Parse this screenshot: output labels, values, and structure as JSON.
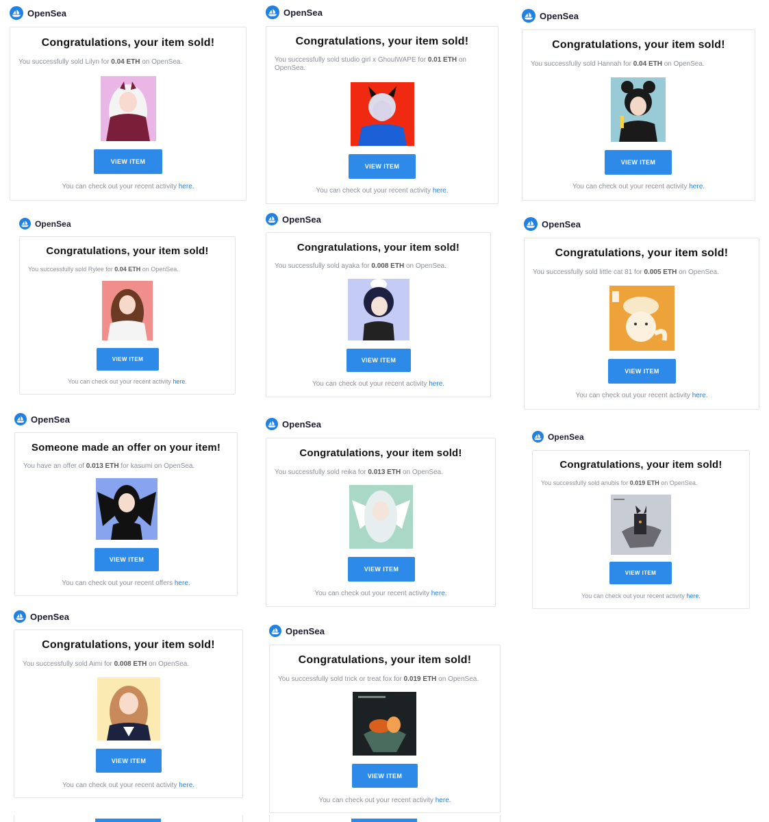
{
  "brand": "OpenSea",
  "button_label": "VIEW ITEM",
  "link_label": "here.",
  "colors": {
    "accent": "#2e8ae8",
    "link": "#2081e2",
    "muted": "#8a8f98"
  },
  "cards": [
    {
      "title": "Congratulations, your item sold!",
      "pre": "You successfully sold Lilyn for ",
      "amount": "0.04 ETH",
      "post": " on OpenSea.",
      "foot": "You can check out your recent activity "
    },
    {
      "title": "Congratulations, your item sold!",
      "pre": "You successfully sold studio girl x GhoulWAPE for ",
      "amount": "0.01 ETH",
      "post": " on OpenSea.",
      "foot": "You can check out your recent activity "
    },
    {
      "title": "Congratulations, your item sold!",
      "pre": "You successfully sold Hannah for ",
      "amount": "0.04 ETH",
      "post": " on OpenSea.",
      "foot": "You can check out your recent activity "
    },
    {
      "title": "Congratulations, your item sold!",
      "pre": "You successfully sold Rylee for ",
      "amount": "0.04 ETH",
      "post": " on OpenSea.",
      "foot": "You can check out your recent activity "
    },
    {
      "title": "Congratulations, your item sold!",
      "pre": "You successfully sold ayaka for ",
      "amount": "0.008 ETH",
      "post": " on OpenSea.",
      "foot": "You can check out your recent activity "
    },
    {
      "title": "Congratulations, your item sold!",
      "pre": "You successfully sold little cat 81 for ",
      "amount": "0.005 ETH",
      "post": " on OpenSea.",
      "foot": "You can check out your recent activity "
    },
    {
      "title": "Someone made an offer on your item!",
      "pre": "You have an offer of ",
      "amount": "0.013 ETH",
      "post": " for kasumi on OpenSea.",
      "foot": "You can check out your recent offers "
    },
    {
      "title": "Congratulations, your item sold!",
      "pre": "You successfully sold reika for ",
      "amount": "0.013 ETH",
      "post": " on OpenSea.",
      "foot": "You can check out your recent activity "
    },
    {
      "title": "Congratulations, your item sold!",
      "pre": "You successfully sold anubis for ",
      "amount": "0.019 ETH",
      "post": " on OpenSea.",
      "foot": "You can check out your recent activity "
    },
    {
      "title": "Congratulations, your item sold!",
      "pre": "You successfully sold Aimi for ",
      "amount": "0.008 ETH",
      "post": " on OpenSea.",
      "foot": "You can check out your recent activity "
    },
    {
      "title": "Congratulations, your item sold!",
      "pre": "You successfully sold trick or treat fox for ",
      "amount": "0.019 ETH",
      "post": " on OpenSea.",
      "foot": "You can check out your recent activity "
    }
  ],
  "art": {
    "a1": {
      "bg": "#e9b6e6",
      "hair": "#f4f4f4",
      "skin": "#f7d9cf",
      "accent": "#7a1e3a"
    },
    "a2": {
      "bg": "#f02a10",
      "hair": "#dcdce8",
      "skin": "#d8d3e8",
      "accent": "#1c60d8"
    },
    "a3": {
      "bg": "#98cbd6",
      "hair": "#1a1a1a",
      "skin": "#f3d7c7",
      "accent": "#1a1a1a"
    },
    "a4": {
      "bg": "#f08e8c",
      "hair": "#6a3a22",
      "skin": "#f6d9c9",
      "accent": "#f4f4f4"
    },
    "a5": {
      "bg": "#c4cbf4",
      "hair": "#1e2040",
      "skin": "#f4e2d8",
      "accent": "#222"
    },
    "a6": {
      "bg": "#eea23a",
      "hair": "#f7e8c8",
      "skin": "#fbf1de",
      "accent": "#e08a1c"
    },
    "a7": {
      "bg": "#89a4ee",
      "hair": "#111111",
      "skin": "#f6dccd",
      "accent": "#111111"
    },
    "a8": {
      "bg": "#a9d8c6",
      "hair": "#e6eef0",
      "skin": "#f5e4da",
      "accent": "#ffffff"
    },
    "a9": {
      "bg": "#c8ccd4",
      "hair": "#2a2a2e",
      "skin": "#6a6a70",
      "accent": "#d8a24a"
    },
    "a10": {
      "bg": "#fbeab2",
      "hair": "#c88a5a",
      "skin": "#f8dccb",
      "accent": "#1c2340"
    },
    "a11": {
      "bg": "#1c2224",
      "hair": "#d8601c",
      "skin": "#4a6c5e",
      "accent": "#f2a050"
    }
  }
}
